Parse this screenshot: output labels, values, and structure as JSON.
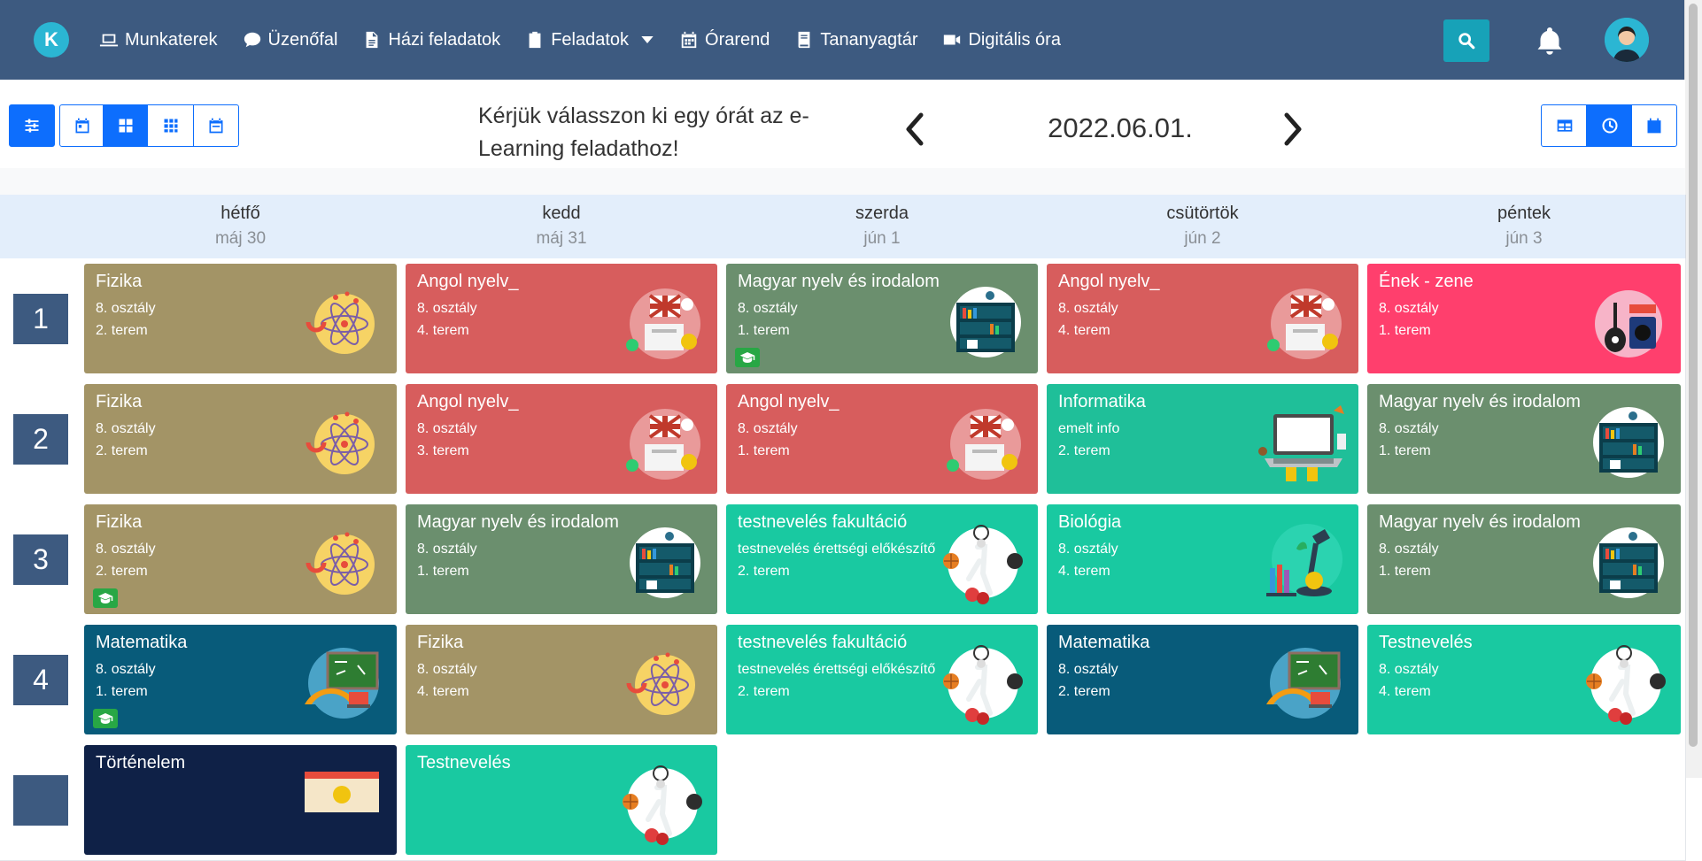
{
  "nav": {
    "items": [
      {
        "label": "Munkaterek",
        "icon": "laptop-icon"
      },
      {
        "label": "Üzenőfal",
        "icon": "message-icon"
      },
      {
        "label": "Házi feladatok",
        "icon": "document-icon"
      },
      {
        "label": "Feladatok",
        "icon": "clipboard-icon"
      },
      {
        "label": "Órarend",
        "icon": "calendar-icon"
      },
      {
        "label": "Tananyagtár",
        "icon": "book-icon"
      },
      {
        "label": "Digitális óra",
        "icon": "video-icon"
      }
    ]
  },
  "logo": {
    "letter": "K"
  },
  "toolbar": {
    "prompt": "Kérjük válasszon ki egy órát az e-Learning feladathoz!",
    "date": "2022.06.01."
  },
  "days": [
    {
      "name": "hétfő",
      "date": "máj 30"
    },
    {
      "name": "kedd",
      "date": "máj 31"
    },
    {
      "name": "szerda",
      "date": "jún 1"
    },
    {
      "name": "csütörtök",
      "date": "jún 2"
    },
    {
      "name": "péntek",
      "date": "jún 3"
    }
  ],
  "periods": [
    "1",
    "2",
    "3",
    "4"
  ],
  "lessons": [
    {
      "subject": "Fizika",
      "class": "8. osztály",
      "room": "2. terem",
      "color": "#a39466",
      "illustration": "physics-atom-illustration",
      "cap": false
    },
    {
      "subject": "Angol nyelv_",
      "class": "8. osztály",
      "room": "4. terem",
      "color": "#d75d5d",
      "illustration": "english-flag-illustration",
      "cap": false
    },
    {
      "subject": "Magyar nyelv és irodalom",
      "class": "8. osztály",
      "room": "1. terem",
      "color": "#6b8f6e",
      "illustration": "bookshelf-illustration",
      "cap": true
    },
    {
      "subject": "Angol nyelv_",
      "class": "8. osztály",
      "room": "4. terem",
      "color": "#d75d5d",
      "illustration": "english-flag-illustration",
      "cap": false
    },
    {
      "subject": "Ének - zene",
      "class": "8. osztály",
      "room": "1. terem",
      "color": "#ff3f6d",
      "illustration": "music-guitar-illustration",
      "cap": false
    },
    {
      "subject": "Fizika",
      "class": "8. osztály",
      "room": "2. terem",
      "color": "#a39466",
      "illustration": "physics-atom-illustration",
      "cap": false
    },
    {
      "subject": "Angol nyelv_",
      "class": "8. osztály",
      "room": "3. terem",
      "color": "#d75d5d",
      "illustration": "english-flag-illustration",
      "cap": false
    },
    {
      "subject": "Angol nyelv_",
      "class": "8. osztály",
      "room": "1. terem",
      "color": "#d75d5d",
      "illustration": "english-flag-illustration",
      "cap": false
    },
    {
      "subject": "Informatika",
      "class": "emelt info",
      "room": "2. terem",
      "color": "#1fbf99",
      "illustration": "laptop-illustration",
      "cap": false
    },
    {
      "subject": "Magyar nyelv és irodalom",
      "class": "8. osztály",
      "room": "1. terem",
      "color": "#6b8f6e",
      "illustration": "bookshelf-illustration",
      "cap": false
    },
    {
      "subject": "Fizika",
      "class": "8. osztály",
      "room": "2. terem",
      "color": "#a39466",
      "illustration": "physics-atom-illustration",
      "cap": true
    },
    {
      "subject": "Magyar nyelv és irodalom",
      "class": "8. osztály",
      "room": "1. terem",
      "color": "#6b8f6e",
      "illustration": "bookshelf-illustration",
      "cap": false
    },
    {
      "subject": "testnevelés fakultáció",
      "class": "testnevelés érettségi előkészítő",
      "room": "2. terem",
      "color": "#19c9a1",
      "illustration": "sports-illustration",
      "cap": false
    },
    {
      "subject": "Biológia",
      "class": "8. osztály",
      "room": "4. terem",
      "color": "#19c9a1",
      "illustration": "microscope-illustration",
      "cap": false
    },
    {
      "subject": "Magyar nyelv és irodalom",
      "class": "8. osztály",
      "room": "1. terem",
      "color": "#6b8f6e",
      "illustration": "bookshelf-illustration",
      "cap": false
    },
    {
      "subject": "Matematika",
      "class": "8. osztály",
      "room": "1. terem",
      "color": "#085b7a",
      "illustration": "math-board-illustration",
      "cap": true
    },
    {
      "subject": "Fizika",
      "class": "8. osztály",
      "room": "4. terem",
      "color": "#a39466",
      "illustration": "physics-atom-illustration",
      "cap": false
    },
    {
      "subject": "testnevelés fakultáció",
      "class": "testnevelés érettségi előkészítő",
      "room": "2. terem",
      "color": "#19c9a1",
      "illustration": "sports-illustration",
      "cap": false
    },
    {
      "subject": "Matematika",
      "class": "8. osztály",
      "room": "2. terem",
      "color": "#085b7a",
      "illustration": "math-board-illustration",
      "cap": false
    },
    {
      "subject": "Testnevelés",
      "class": "8. osztály",
      "room": "4. terem",
      "color": "#19c9a1",
      "illustration": "sports-illustration",
      "cap": false
    },
    {
      "subject": "Történelem",
      "class": "",
      "room": "",
      "color": "#0f2147",
      "illustration": "history-illustration",
      "cap": false
    },
    {
      "subject": "Testnevelés",
      "class": "",
      "room": "",
      "color": "#19c9a1",
      "illustration": "sports-illustration",
      "cap": false
    }
  ]
}
